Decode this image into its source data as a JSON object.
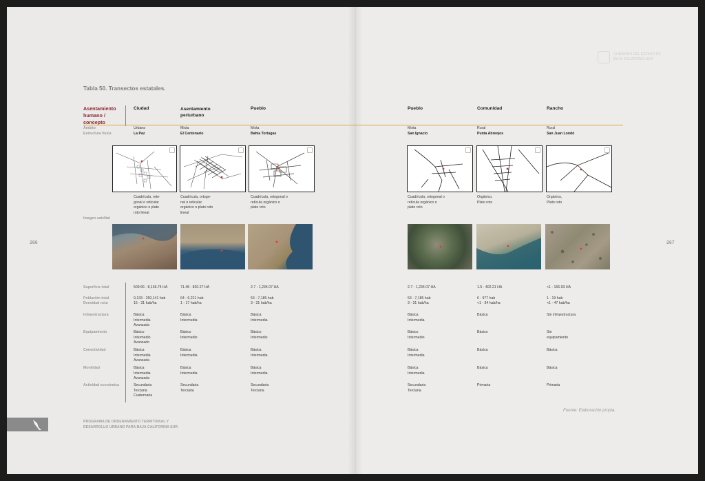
{
  "header": {
    "gov_line1": "GOBIERNO DEL ESTADO DE",
    "gov_line2": "BAJA CALIFORNIA SUR"
  },
  "table_title": "Tabla 50. Transectos estatales.",
  "concept_label": "Asentamiento humano / concepto",
  "row_labels": {
    "ambito": "Ámbito",
    "estructura": "Estructura física",
    "imagen": "Imagen satelital",
    "superficie": "Superficie total",
    "poblacion": "Población total",
    "densidad": "Densidad neta",
    "infraestructura": "Infraestructura",
    "equipamiento": "Equipamiento",
    "conectividad": "Conectividad",
    "movilidad": "Movilidad",
    "actividad": "Actividad económica"
  },
  "columns": [
    {
      "header": "Ciudad",
      "ambito": "Urbana",
      "lugar": "La Paz",
      "estructura": "Cuadrícula, orto-\ngonal o reticular\norgánico o plato\nroto lineal",
      "superficie": "509.66 - 8,166.74 HA",
      "poblacion": "9,133 - 250,141 hab",
      "densidad": "15 - 31 hab/ha",
      "infraestructura": "Básica\nIntermedia\nAvanzada",
      "equipamiento": "Básico\nIntermedio\nAvanzado",
      "conectividad": "Básica\nIntermedia\nAvanzada",
      "movilidad": "Básica\nIntermedia\nAvanzada",
      "actividad": "Secundaria\nTerciaria\nCuaternaria"
    },
    {
      "header": "Asentamiento periurbano",
      "ambito": "Mixta",
      "lugar": "El Centenario",
      "estructura": "Cuadrícula, ortogo-\nnal o reticular\norgánico o plato roto\nlineal",
      "superficie": "71.48 - 820.27 HA",
      "poblacion": "64 - 6,221 hab",
      "densidad": "1 - 17 hab/ha",
      "infraestructura": "Básica\nIntermedia",
      "equipamiento": "Básico\nIntermedio",
      "conectividad": "Básica\nIntermedia",
      "movilidad": "Básica\nIntermedia",
      "actividad": "Secundaria\nTerciaria"
    },
    {
      "header": "Pueblo",
      "ambito": "Mixta",
      "lugar": "Bahía Tortugas",
      "estructura": "Cuadrícula, ortogonal o\nretícula orgánico o\nplato roto",
      "superficie": "2.7 - 1,234.07 HA",
      "poblacion": "53 - 7,185 hab",
      "densidad": "3 - 31 hab/ha",
      "infraestructura": "Básica\nIntermedia",
      "equipamiento": "Básico\nIntermedio",
      "conectividad": "Básica\nIntermedia",
      "movilidad": "Básica\nIntermedia",
      "actividad": "Secundaria\nTerciaria"
    },
    {
      "header": "Pueblo",
      "ambito": "Mixta",
      "lugar": "San Ignacio",
      "estructura": "Cuadrícula, ortogonal o\nretícula orgánico o\nplato roto",
      "superficie": "2.7 - 1,234.07 HA",
      "poblacion": "53 - 7,185 hab",
      "densidad": "3 - 31 hab/ha",
      "infraestructura": "Básica\nIntermedia",
      "equipamiento": "Básico\nIntermedio",
      "conectividad": "Básica\nIntermedia",
      "movilidad": "Básica\nIntermedia",
      "actividad": "Secundaria\nTerciaria"
    },
    {
      "header": "Comunidad",
      "ambito": "Rural",
      "lugar": "Punta Abreojos",
      "estructura": "Orgánico,\nPlato roto",
      "superficie": "1.5 - 402.21 HA",
      "poblacion": "6 - 977 hab",
      "densidad": "<1 - 34 hab/ha",
      "infraestructura": "Básica",
      "equipamiento": "Básico",
      "conectividad": "Básica",
      "movilidad": "Básica",
      "actividad": "Primaria"
    },
    {
      "header": "Rancho",
      "ambito": "Rural",
      "lugar": "San Juan  Londó",
      "estructura": "Orgánico,\nPlato roto",
      "superficie": "<1 - 166.93 HA",
      "poblacion": "1 - 19 hab",
      "densidad": "<1 - 47 hab/ha",
      "infraestructura": "Sin infraestructura",
      "equipamiento": "Sin\nequipamiento",
      "conectividad": "Básica",
      "movilidad": "Básica",
      "actividad": "Primaria"
    }
  ],
  "source": "Fuente: Elaboración propia.",
  "page_left": "266",
  "page_right": "267",
  "footer": "PROGRAMA DE ORDENAMIENTO TERRITORIAL Y\nDESARROLLO URBANO PARA BAJA CALIFORNIA SUR",
  "colors": {
    "accent": "#8b2430",
    "rule": "#e0a63a"
  }
}
